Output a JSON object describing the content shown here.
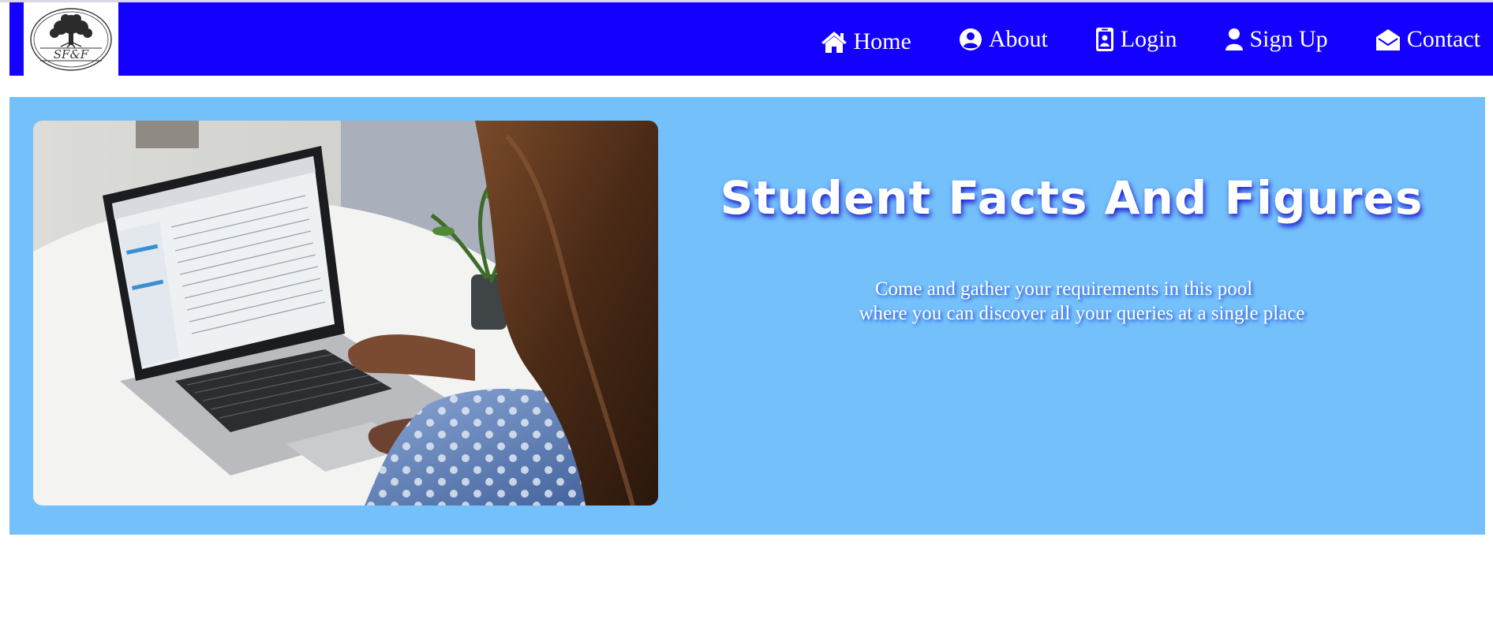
{
  "brand": {
    "logo_text": "SF&F",
    "logo_alt": "tree logo"
  },
  "nav": {
    "items": [
      {
        "label": "Home",
        "icon": "home-icon"
      },
      {
        "label": "About",
        "icon": "user-circle-icon"
      },
      {
        "label": "Login",
        "icon": "id-badge-icon"
      },
      {
        "label": "Sign Up",
        "icon": "user-icon"
      },
      {
        "label": "Contact",
        "icon": "envelope-open-icon"
      }
    ]
  },
  "hero": {
    "title": "Student Facts And Figures",
    "subtitle_line1": "Come and gather your requirements in this pool",
    "subtitle_line2": "where you can discover all your queries at a single place"
  },
  "colors": {
    "navbar": "#1400ff",
    "hero_background": "#74c0fb",
    "text": "#ffffff"
  }
}
